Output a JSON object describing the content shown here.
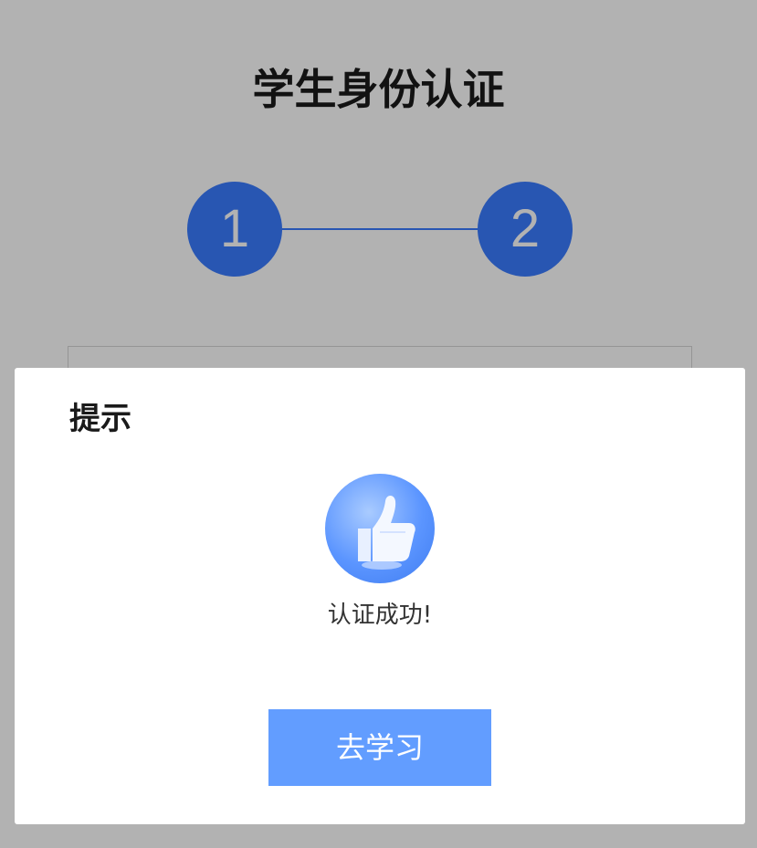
{
  "page": {
    "title": "学生身份认证",
    "steps": [
      "1",
      "2"
    ]
  },
  "dialog": {
    "title": "提示",
    "icon": "thumbs-up-icon",
    "message": "认证成功!",
    "button_label": "去学习"
  },
  "colors": {
    "step_accent": "#3a7bff",
    "button": "#629dff",
    "overlay": "rgba(0,0,0,0.3)"
  }
}
